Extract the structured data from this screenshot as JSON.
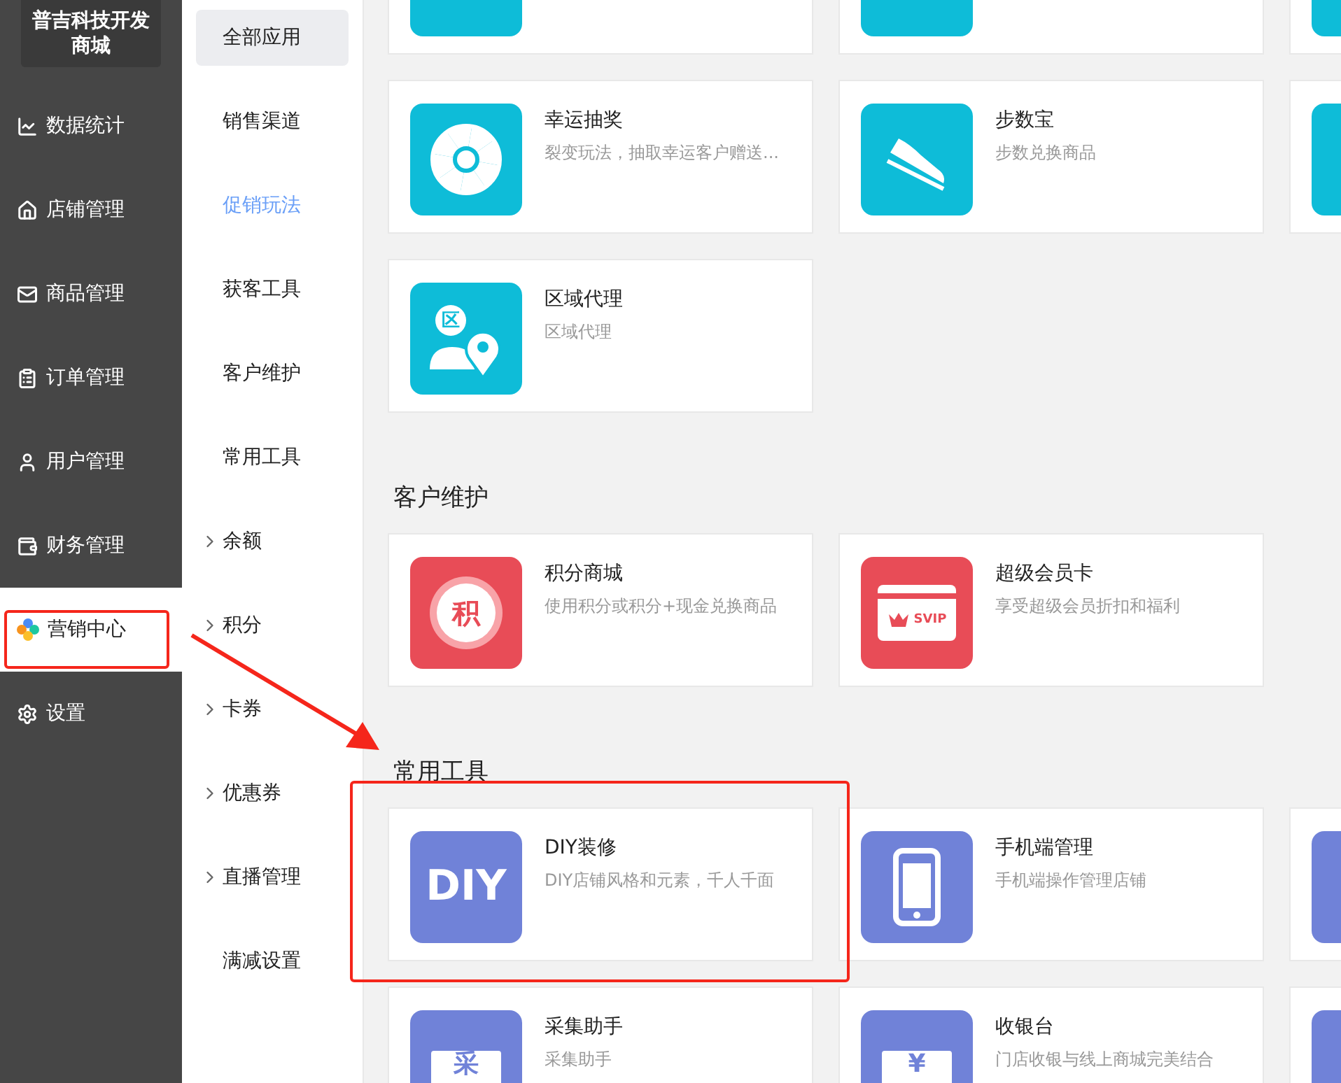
{
  "brand": {
    "title": "普吉科技开发商城"
  },
  "sidebar": {
    "items": [
      {
        "label": "数据统计",
        "selected": false
      },
      {
        "label": "店铺管理",
        "selected": false
      },
      {
        "label": "商品管理",
        "selected": false
      },
      {
        "label": "订单管理",
        "selected": false
      },
      {
        "label": "用户管理",
        "selected": false
      },
      {
        "label": "财务管理",
        "selected": false
      },
      {
        "label": "营销中心",
        "selected": true
      },
      {
        "label": "设置",
        "selected": false
      }
    ]
  },
  "submenu": {
    "items": [
      {
        "label": "全部应用",
        "selected": true,
        "active": false,
        "expandable": false
      },
      {
        "label": "销售渠道",
        "selected": false,
        "active": false,
        "expandable": false
      },
      {
        "label": "促销玩法",
        "selected": false,
        "active": true,
        "expandable": false
      },
      {
        "label": "获客工具",
        "selected": false,
        "active": false,
        "expandable": false
      },
      {
        "label": "客户维护",
        "selected": false,
        "active": false,
        "expandable": false
      },
      {
        "label": "常用工具",
        "selected": false,
        "active": false,
        "expandable": false
      },
      {
        "label": "余额",
        "selected": false,
        "active": false,
        "expandable": true
      },
      {
        "label": "积分",
        "selected": false,
        "active": false,
        "expandable": true
      },
      {
        "label": "卡券",
        "selected": false,
        "active": false,
        "expandable": true
      },
      {
        "label": "优惠券",
        "selected": false,
        "active": false,
        "expandable": true
      },
      {
        "label": "直播管理",
        "selected": false,
        "active": false,
        "expandable": true
      },
      {
        "label": "满减设置",
        "selected": false,
        "active": false,
        "expandable": false
      }
    ]
  },
  "sections": [
    {
      "cards": [
        {
          "color": "#0ebcd8"
        },
        {
          "color": "#0ebcd8"
        },
        {
          "color": "#0ebcd8"
        },
        {
          "title": "幸运抽奖",
          "description": "裂变玩法，抽取幸运客户赠送...",
          "color": "#0ebcd8"
        },
        {
          "title": "步数宝",
          "description": "步数兑换商品",
          "color": "#0ebcd8"
        },
        {
          "color": "#0ebcd8"
        },
        {
          "title": "区域代理",
          "description": "区域代理",
          "color": "#0ebcd8",
          "icon_text": "区"
        }
      ]
    },
    {
      "title": "客户维护",
      "cards": [
        {
          "title": "积分商城",
          "description": "使用积分或积分+现金兑换商品",
          "color": "#e84c57",
          "icon_text": "积"
        },
        {
          "title": "超级会员卡",
          "description": "享受超级会员折扣和福利",
          "color": "#e84c57",
          "icon_text": "SVIP"
        }
      ]
    },
    {
      "title": "常用工具",
      "cards": [
        {
          "title": "DIY装修",
          "description": "DIY店铺风格和元素，千人千面",
          "color": "#7082d8",
          "icon_text": "DIY"
        },
        {
          "title": "手机端管理",
          "description": "手机端操作管理店铺",
          "color": "#7082d8"
        },
        {
          "color": "#7082d8"
        },
        {
          "title": "采集助手",
          "description": "采集助手",
          "color": "#7082d8",
          "icon_text": "采"
        },
        {
          "title": "收银台",
          "description": "门店收银与线上商城完美结合",
          "color": "#7082d8",
          "icon_text": "¥"
        },
        {
          "color": "#7082d8"
        }
      ]
    }
  ]
}
